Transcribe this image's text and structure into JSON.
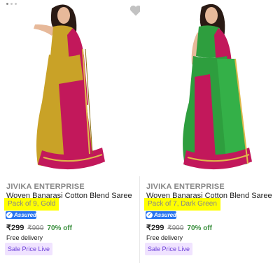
{
  "products": [
    {
      "brand": "JIVIKA ENTERPRISE",
      "title": "Woven Banarasi Cotton Blend Saree",
      "variant": "Pack of 9, Gold",
      "assured_label": "Assured",
      "price": "₹299",
      "mrp": "₹999",
      "discount": "70% off",
      "delivery": "Free delivery",
      "offer": "Sale Price Live",
      "saree_color": "#c9a227",
      "border_color": "#c2185b"
    },
    {
      "brand": "JIVIKA ENTERPRISE",
      "title": "Woven Banarasi Cotton Blend Saree",
      "variant": "Pack of 7, Dark Green",
      "assured_label": "Assured",
      "price": "₹299",
      "mrp": "₹999",
      "discount": "70% off",
      "delivery": "Free delivery",
      "offer": "Sale Price Live",
      "saree_color": "#2e9e3e",
      "border_color": "#c2185b"
    }
  ],
  "colors": {
    "highlight": "#ffff00",
    "discount_green": "#388e3c",
    "assured_blue": "#2874f0",
    "sale_badge_bg": "#f0e3ff"
  }
}
